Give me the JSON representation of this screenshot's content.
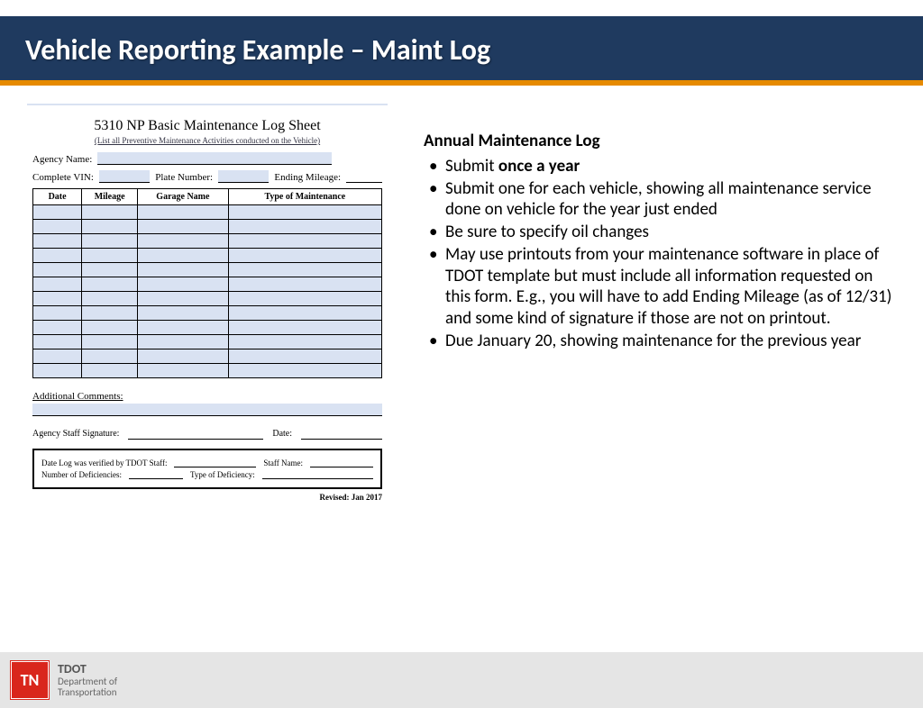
{
  "header": {
    "title": "Vehicle Reporting Example – Maint Log"
  },
  "form": {
    "title": "5310 NP Basic Maintenance Log Sheet",
    "subtitle": "(List all Preventive Maintenance Activities conducted on the Vehicle)",
    "agency_label": "Agency Name:",
    "vin_label": "Complete VIN:",
    "plate_label": "Plate Number:",
    "mileage_label": "Ending Mileage:",
    "cols": {
      "date": "Date",
      "mileage": "Mileage",
      "garage": "Garage Name",
      "type": "Type of Maintenance"
    },
    "additional": "Additional Comments:",
    "sig_label": "Agency Staff Signature:",
    "date_label": "Date:",
    "verify1a": "Date Log was verified by TDOT Staff:",
    "verify1b": "Staff Name:",
    "verify2a": "Number of Deficiencies:",
    "verify2b": "Type of Deficiency:",
    "revised": "Revised: Jan 2017"
  },
  "content": {
    "heading": "Annual Maintenance Log",
    "b1a": "Submit ",
    "b1b": "once a year",
    "b2": "Submit one for each vehicle, showing all maintenance service done on vehicle for the year just ended",
    "b3": "Be sure to specify oil changes",
    "b4": "May use printouts from your maintenance software in place of TDOT template but must include all information requested on this form. E.g., you will have to add Ending Mileage (as of 12/31) and some kind of signature if those are not on printout.",
    "b5": "Due January 20, showing maintenance for the previous year"
  },
  "footer": {
    "badge": "TN",
    "tdot": "TDOT",
    "dept1": "Department of",
    "dept2": "Transportation"
  }
}
